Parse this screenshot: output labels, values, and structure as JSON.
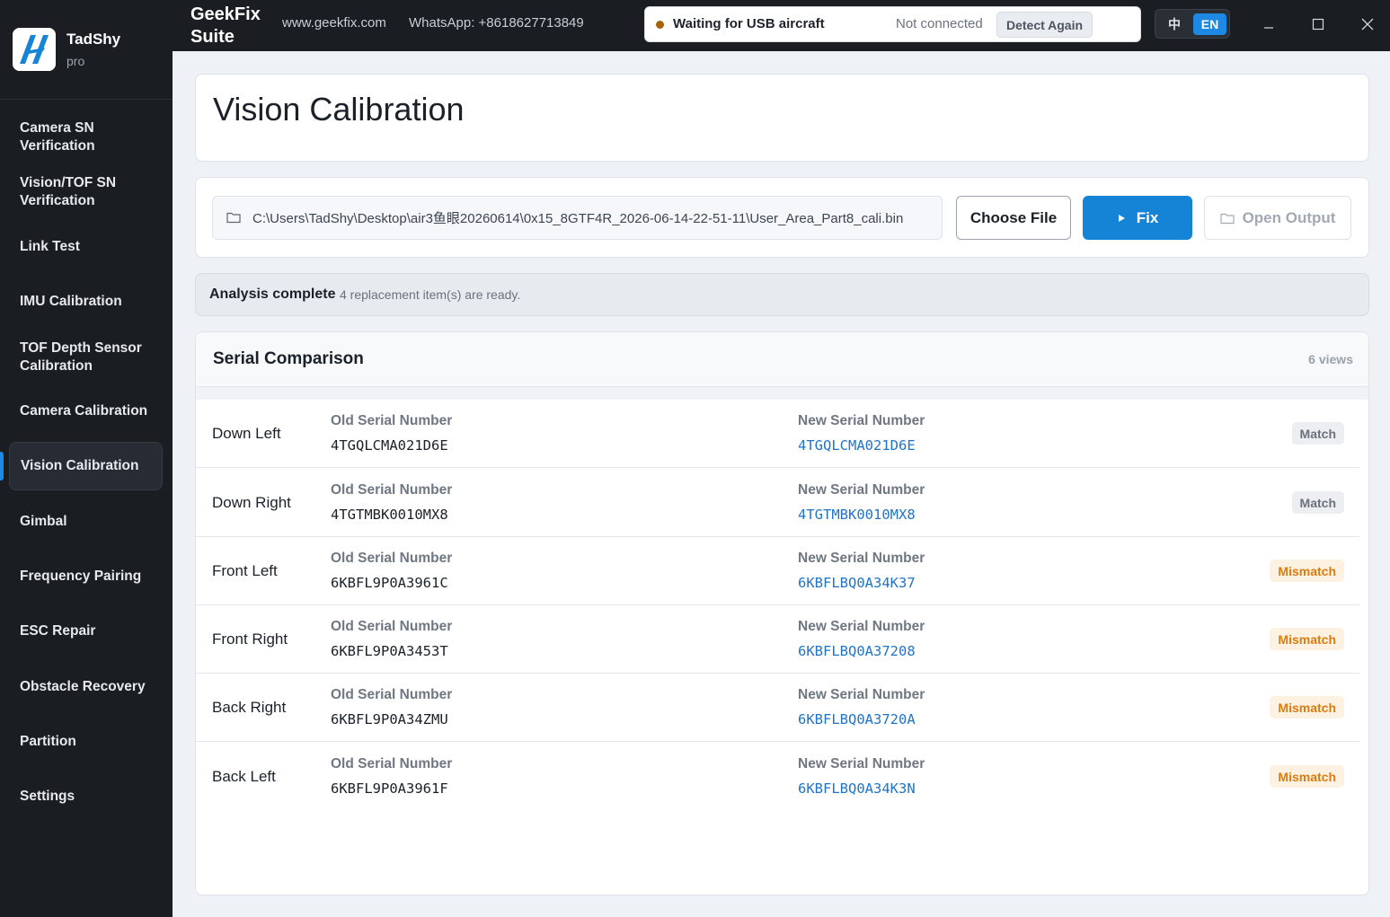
{
  "brand": {
    "name": "TadShy",
    "tier": "pro"
  },
  "topbar": {
    "app_title_line1": "GeekFix",
    "app_title_line2": "Suite",
    "website": "www.geekfix.com",
    "whatsapp": "WhatsApp: +8618627713849",
    "status_text": "Waiting for USB aircraft",
    "connection_text": "Not connected",
    "detect_label": "Detect Again",
    "status_color": "#a8620c",
    "lang_zh": "中",
    "lang_en": "EN",
    "active_lang": "EN"
  },
  "sidebar": {
    "items": [
      {
        "label": "Camera SN Verification"
      },
      {
        "label": "Vision/TOF SN Verification"
      },
      {
        "label": "Link Test"
      },
      {
        "label": "IMU Calibration"
      },
      {
        "label": "TOF Depth Sensor Calibration"
      },
      {
        "label": "Camera Calibration"
      },
      {
        "label": "Vision Calibration",
        "active": true
      },
      {
        "label": "Gimbal"
      },
      {
        "label": "Frequency Pairing"
      },
      {
        "label": "ESC Repair"
      },
      {
        "label": "Obstacle Recovery"
      },
      {
        "label": "Partition"
      },
      {
        "label": "Settings"
      }
    ]
  },
  "page": {
    "title": "Vision Calibration"
  },
  "file": {
    "path": "C:\\Users\\TadShy\\Desktop\\air3鱼眼20260614\\0x15_8GTF4R_2026-06-14-22-51-11\\User_Area_Part8_cali.bin",
    "choose_label": "Choose File",
    "fix_label": "Fix",
    "open_output_label": "Open Output"
  },
  "banner": {
    "title": "Analysis complete",
    "message": "4 replacement item(s) are ready."
  },
  "serial": {
    "title": "Serial Comparison",
    "count_label": "6 views",
    "old_label": "Old Serial Number",
    "new_label": "New Serial Number",
    "rows": [
      {
        "name": "Down Left",
        "old": "4TGQLCMA021D6E",
        "new": "4TGQLCMA021D6E",
        "status": "Match"
      },
      {
        "name": "Down Right",
        "old": "4TGTMBK0010MX8",
        "new": "4TGTMBK0010MX8",
        "status": "Match"
      },
      {
        "name": "Front Left",
        "old": "6KBFL9P0A3961C",
        "new": "6KBFLBQ0A34K37",
        "status": "Mismatch"
      },
      {
        "name": "Front Right",
        "old": "6KBFL9P0A3453T",
        "new": "6KBFLBQ0A37208",
        "status": "Mismatch"
      },
      {
        "name": "Back Right",
        "old": "6KBFL9P0A34ZMU",
        "new": "6KBFLBQ0A3720A",
        "status": "Mismatch"
      },
      {
        "name": "Back Left",
        "old": "6KBFL9P0A3961F",
        "new": "6KBFLBQ0A34K3N",
        "status": "Mismatch"
      }
    ]
  },
  "colors": {
    "accent": "#1584d6",
    "match_badge": "#6b727c",
    "mismatch_badge": "#db7b12"
  }
}
